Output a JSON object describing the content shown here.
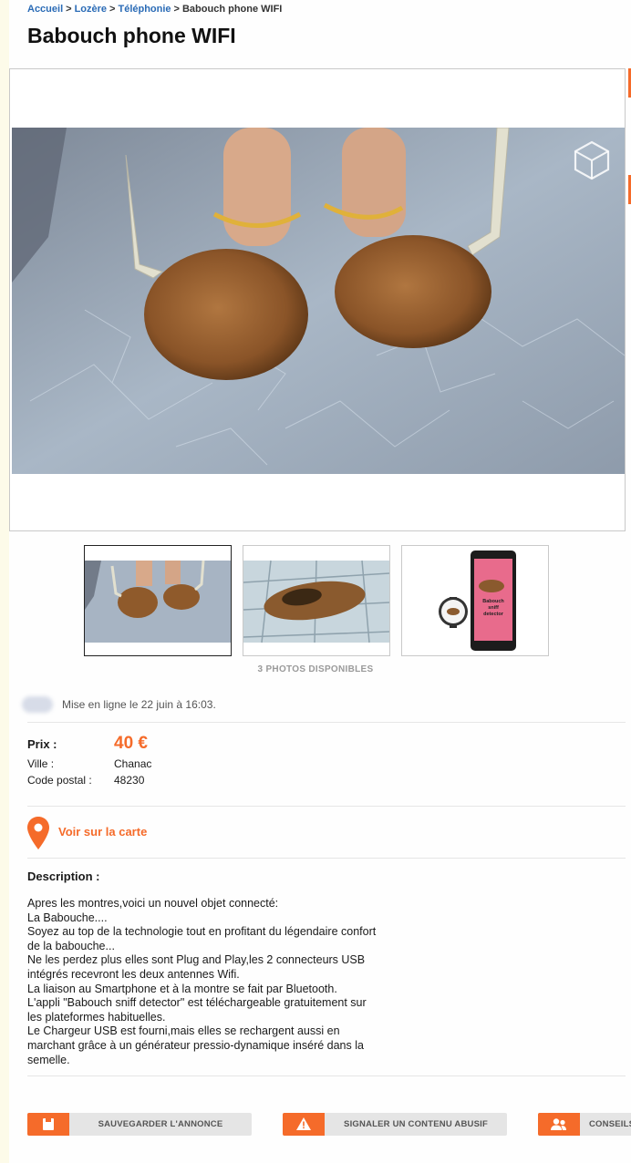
{
  "breadcrumb": {
    "items": [
      "Accueil",
      "Lozère",
      "Téléphonie"
    ],
    "current": "Babouch phone WIFI",
    "separator": ">"
  },
  "title": "Babouch phone WIFI",
  "photos": {
    "count_label": "3 PHOTOS DISPONIBLES",
    "thumbnail_caption": "Babouch sniff detector"
  },
  "posted": "Mise en ligne le 22 juin à 16:03.",
  "info": {
    "price_label": "Prix :",
    "price": "40 €",
    "city_label": "Ville :",
    "city": "Chanac",
    "postal_label": "Code postal :",
    "postal": "48230"
  },
  "map": {
    "label": "Voir sur la carte"
  },
  "description": {
    "title": "Description :",
    "lines": [
      "Apres les montres,voici un nouvel objet connecté:",
      "La Babouche....",
      "Soyez au top de la technologie tout en profitant du légendaire confort",
      "de la babouche...",
      "Ne les perdez plus elles sont Plug and Play,les 2 connecteurs USB",
      "intégrés recevront les deux antennes Wifi.",
      "La liaison au Smartphone et à la montre se fait par Bluetooth.",
      "L'appli \"Babouch sniff detector\" est téléchargeable gratuitement sur",
      "les plateformes habituelles.",
      "Le Chargeur USB est fourni,mais elles se rechargent aussi en",
      "marchant grâce à un générateur pressio-dynamique inséré dans la",
      "semelle."
    ]
  },
  "actions": {
    "save": "SAUVEGARDER L'ANNONCE",
    "report": "SIGNALER UN CONTENU ABUSIF",
    "advice": "CONSEILS"
  },
  "colors": {
    "accent": "#f56b2a",
    "link": "#2a6bb6"
  },
  "icons": {
    "map": "map-pin-icon",
    "save": "floppy-disk-icon",
    "report": "warning-icon",
    "advice": "users-icon"
  }
}
